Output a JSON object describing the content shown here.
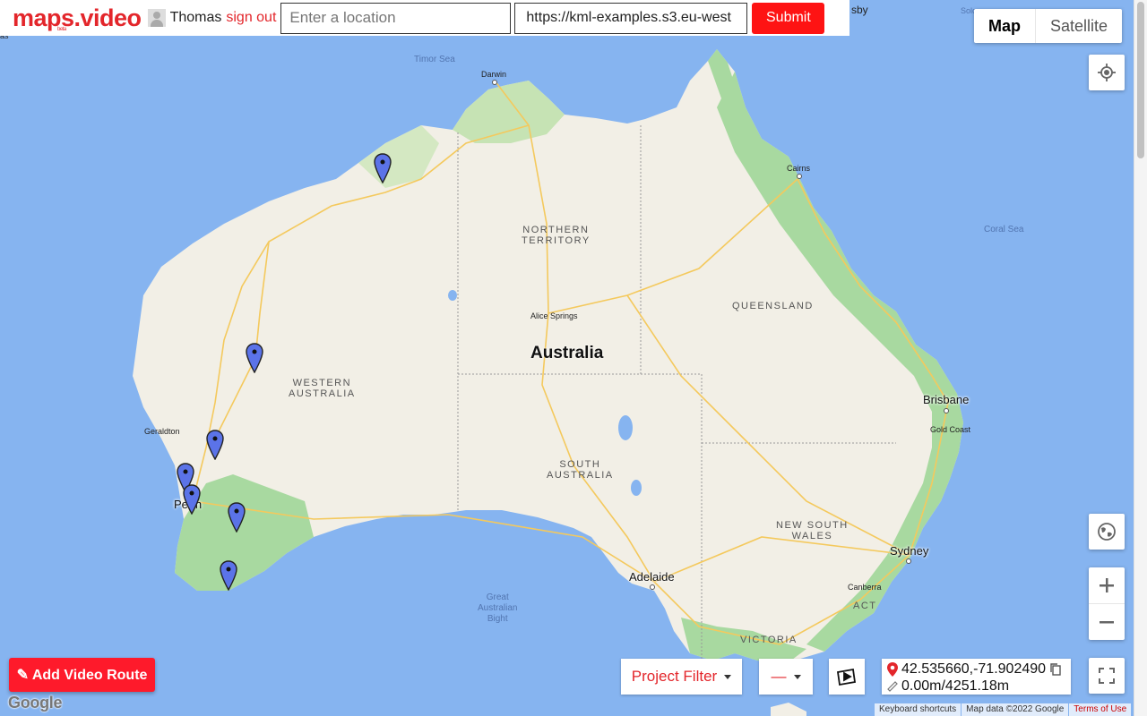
{
  "app": {
    "logo": "maps.video",
    "beta": "beta",
    "username": "Thomas",
    "signout": "sign out",
    "location_placeholder": "Enter a location",
    "kml_url": "https://kml-examples.s3.eu-west",
    "submit": "Submit"
  },
  "map_type": {
    "map": "Map",
    "satellite": "Satellite"
  },
  "map_labels": {
    "timor_sea": "Timor Sea",
    "coral_sea": "Coral Sea",
    "great_australian_bight": [
      "Great",
      "Australian",
      "Bight"
    ],
    "darwin": "Darwin",
    "cairns": "Cairns",
    "alice_springs": "Alice Springs",
    "geraldton": "Geraldton",
    "perth": "Perth",
    "adelaide": "Adelaide",
    "brisbane": "Brisbane",
    "gold_coast": "Gold Coast",
    "sydney": "Sydney",
    "canberra": "Canberra",
    "country": "Australia",
    "northern_territory": [
      "NORTHERN",
      "TERRITORY"
    ],
    "queensland": "QUEENSLAND",
    "western_australia": [
      "WESTERN",
      "AUSTRALIA"
    ],
    "south_australia": [
      "SOUTH",
      "AUSTRALIA"
    ],
    "new_south_wales": [
      "NEW SOUTH",
      "WALES"
    ],
    "victoria": "VICTORIA",
    "act": "ACT",
    "edge_sby": "sby",
    "edge_solo": "Solo",
    "edge_as": "as"
  },
  "markers": {
    "count": 7,
    "color": "#5b73e8"
  },
  "bottom": {
    "add_route": "✎ Add Video Route",
    "project_filter": "Project Filter",
    "line_style": "—",
    "coords": "42.535660,-71.902490",
    "distance": "0.00m/4251.18m"
  },
  "attribution": {
    "google": "Google",
    "shortcuts": "Keyboard shortcuts",
    "map_data": "Map data ©2022 Google",
    "terms": "Terms of Use"
  },
  "colors": {
    "brand_red": "#e3262b",
    "button_red": "#fe1313",
    "ocean": "#86b4f0",
    "land": "#f2efe6",
    "vegetation": "#a8d9a0"
  }
}
